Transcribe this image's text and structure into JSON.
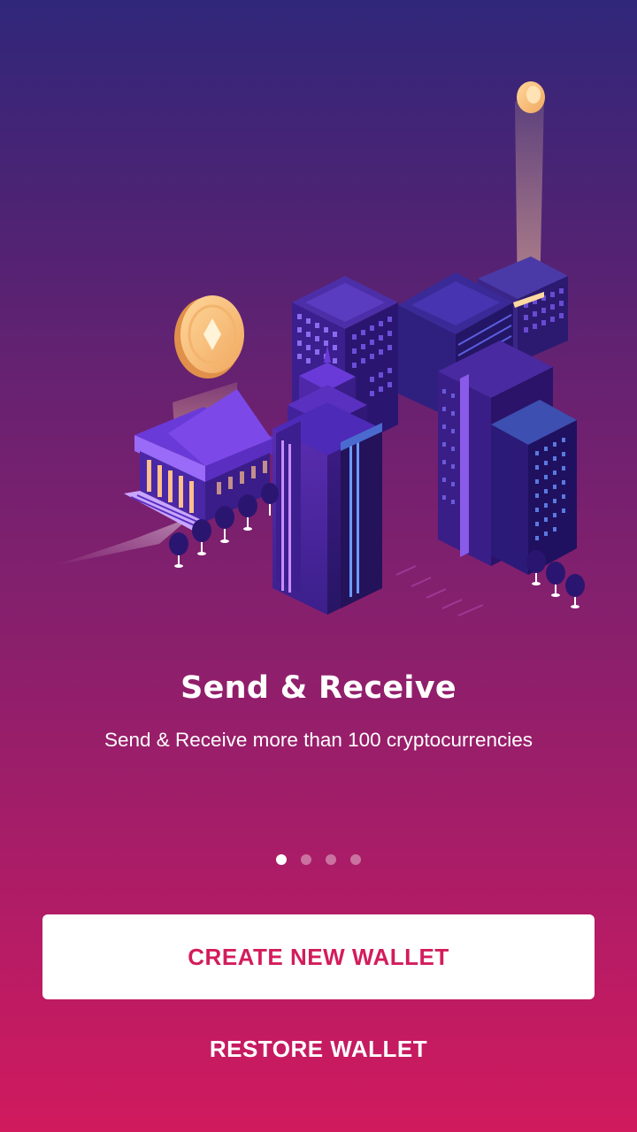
{
  "onboarding": {
    "title": "Send & Receive",
    "subtitle": "Send & Receive more than 100 cryptocurrencies",
    "illustration": "isometric-city-crypto-illustration",
    "pager": {
      "total": 4,
      "active_index": 0
    }
  },
  "actions": {
    "create_label": "CREATE NEW WALLET",
    "restore_label": "RESTORE WALLET"
  },
  "colors": {
    "gradient_top": "#30277a",
    "gradient_bottom": "#d11a5e",
    "primary_accent": "#d31c5c",
    "coin": "#ffc27a"
  }
}
